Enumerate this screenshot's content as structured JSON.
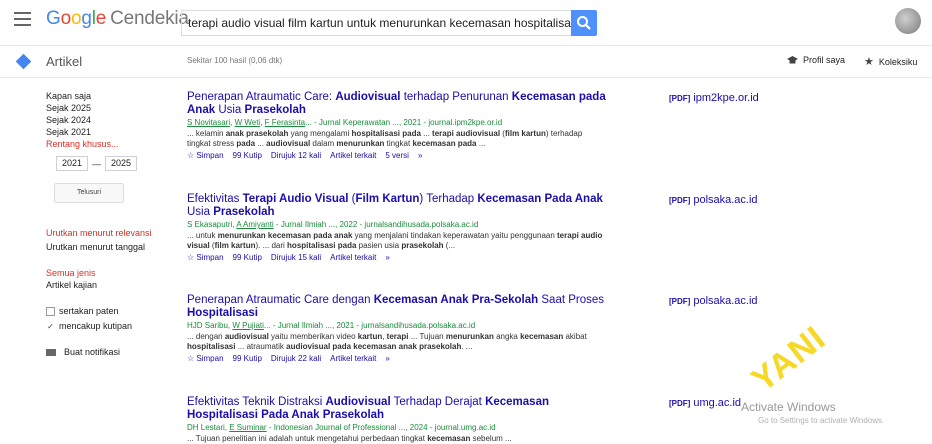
{
  "header": {
    "logo_brand": "Google",
    "logo_product": "Cendekia",
    "search_query": "terapi audio visual film kartun untuk menurunkan kecemasan hospitalisasi pa"
  },
  "subbar": {
    "section_title": "Artikel",
    "result_count": "Sekitar 100 hasil (0,06 dtk)",
    "profile_label": "Profil saya",
    "collection_label": "Koleksiku"
  },
  "sidebar": {
    "time_filters": [
      "Kapan saja",
      "Sejak 2025",
      "Sejak 2024",
      "Sejak 2021"
    ],
    "custom_range": "Rentang khusus...",
    "year_from": "2021",
    "year_to": "2025",
    "search_range_button": "Telusuri",
    "sort_relevance": "Urutkan menurut relevansi",
    "sort_date": "Urutkan menurut tanggal",
    "type_all": "Semua jenis",
    "type_review": "Artikel kajian",
    "include_patents": "sertakan paten",
    "include_citations": "mencakup kutipan",
    "create_alert": "Buat notifikasi"
  },
  "results": [
    {
      "title_html": "Penerapan Atraumatic Care: <b>Audiovisual</b> terhadap Penurunan <b>Kecemasan pada Anak</b> Usia <b>Prasekolah</b>",
      "authors_html": "<u>S Novitasari</u>, <u>W Weti</u>, <u>F Ferasinta</u>... - Jurnal Keperawatan ..., 2021 - journal.ipm2kpe.or.id",
      "snippet_html": "... kelamin <b>anak prasekolah</b> yang mengalami <b>hospitalisasi pada</b> ... <b>terapi audiovisual</b> (<b>film kartun</b>) terhadap tingkat stress <b>pada</b> ... <b>audiovisual</b> dalam <b>menurunkan</b> tingkat <b>kecemasan pada</b> ...",
      "save": "Simpan",
      "cite": "Kutip",
      "cited_by": "Dirujuk 12 kali",
      "related": "Artikel terkait",
      "versions": "5 versi",
      "pdf_tag": "[PDF]",
      "pdf_source": "ipm2kpe.or.id"
    },
    {
      "title_html": "Efektivitas <b>Terapi Audio Visual</b> (<b>Film Kartun</b>) Terhadap <b>Kecemasan Pada Anak</b> Usia <b>Prasekolah</b>",
      "authors_html": "S Ekasaputri, <u>A Amiyanti</u> - Jurnal Ilmiah ..., 2022 - jurnalsandihusada.polsaka.ac.id",
      "snippet_html": "... untuk <b>menurunkan kecemasan pada anak</b> yang menjalani tindakan keperawatan yaitu penggunaan <b>terapi audio visual</b> (<b>film kartun</b>). ... dari <b>hospitalisasi pada</b> pasien usia <b>prasekolah</b> (...",
      "save": "Simpan",
      "cite": "Kutip",
      "cited_by": "Dirujuk 15 kali",
      "related": "Artikel terkait",
      "versions": "",
      "pdf_tag": "[PDF]",
      "pdf_source": "polsaka.ac.id"
    },
    {
      "title_html": "Penerapan Atraumatic Care dengan <b>Kecemasan Anak Pra-Sekolah</b> Saat Proses <b>Hospitalisasi</b>",
      "authors_html": "HJD Saribu, <u>W Pujiati</u>... - Jurnal Ilmiah ..., 2021 - jurnalsandihusada.polsaka.ac.id",
      "snippet_html": "... dengan <b>audiovisual</b> yaitu memberikan video <b>kartun</b>, <b>terapi</b> ... Tujuan <b>menurunkan</b> angka <b>kecemasan</b> akibat <b>hospitalisasi</b> ... atraumatik <b>audiovisual pada kecemasan anak prasekolah</b>. ...",
      "save": "Simpan",
      "cite": "Kutip",
      "cited_by": "Dirujuk 22 kali",
      "related": "Artikel terkait",
      "versions": "",
      "pdf_tag": "[PDF]",
      "pdf_source": "polsaka.ac.id"
    },
    {
      "title_html": "Efektivitas Teknik Distraksi <b>Audiovisual</b> Terhadap Derajat <b>Kecemasan Hospitalisasi Pada Anak Prasekolah</b>",
      "authors_html": "DH Lestari, <u>E Suminar</u> - Indonesian Journal of Professional ..., 2024 - journal.umg.ac.id",
      "snippet_html": "... Tujuan penelitian ini adalah untuk mengetahui perbedaan tingkat <b>kecemasan</b> sebelum ...",
      "save": "",
      "cite": "",
      "cited_by": "",
      "related": "",
      "versions": "",
      "pdf_tag": "[PDF]",
      "pdf_source": "umg.ac.id"
    }
  ],
  "overlays": {
    "watermark_text": "YANI",
    "activate_title": "Activate Windows",
    "activate_sub": "Go to Settings to activate Windows."
  },
  "colors": {
    "link_blue": "#1a0dab",
    "author_green": "#1a8c3a",
    "active_red": "#d93025",
    "search_blue": "#4d90fe",
    "watermark_yellow": "#f5d200"
  }
}
